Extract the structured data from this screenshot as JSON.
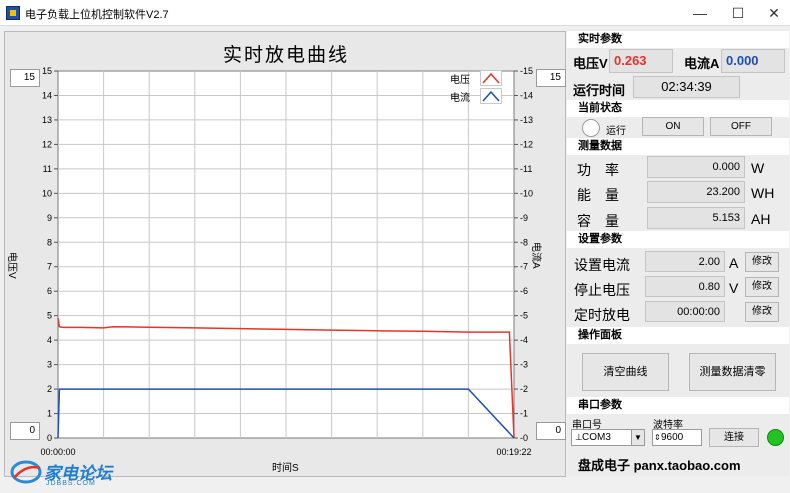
{
  "window": {
    "title": "电子负载上位机控制软件V2.7",
    "minimize_glyph": "—",
    "maximize_glyph": "☐",
    "close_glyph": "✕",
    "icon": "labview-app-icon"
  },
  "chart": {
    "title": "实时放电曲线",
    "y_left_max_box": "15",
    "y_left_min_box": "0",
    "y_right_max_box": "15",
    "y_right_min_box": "0",
    "x_start_label": "00:00:00",
    "x_end_label": "00:19:22"
  },
  "chart_data": {
    "type": "line",
    "title": "实时放电曲线",
    "xlabel": "时间S",
    "ylabel": "电压V",
    "y2label": "电流A",
    "xlim": [
      "00:00:00",
      "00:19:22"
    ],
    "ylim": [
      0,
      15
    ],
    "y2lim": [
      0,
      15
    ],
    "x_tick_labels": [
      "00:00:00",
      "00:19:22"
    ],
    "y_ticks": [
      0,
      1,
      2,
      3,
      4,
      5,
      6,
      7,
      8,
      9,
      10,
      11,
      12,
      13,
      14,
      15
    ],
    "y_tick_labels": [
      "0",
      "1",
      "2",
      "3",
      "4",
      "5",
      "6",
      "7",
      "8",
      "9",
      "10",
      "11",
      "12",
      "13",
      "14",
      "15"
    ],
    "y2_tick_labels": [
      "-0",
      "-1",
      "-2",
      "-3",
      "-4",
      "-5",
      "-6",
      "-7",
      "-8",
      "-9",
      "-10",
      "-11",
      "-12",
      "-13",
      "-14",
      "-15"
    ],
    "grid": true,
    "legend_position": "top-right",
    "series": [
      {
        "name": "电压",
        "color": "#e8332a",
        "x": [
          0,
          0.003,
          0.01,
          0.05,
          0.1,
          0.12,
          0.2,
          0.3,
          0.4,
          0.5,
          0.6,
          0.7,
          0.8,
          0.9,
          0.95,
          0.99,
          1.0
        ],
        "values": [
          4.9,
          4.55,
          4.52,
          4.52,
          4.5,
          4.55,
          4.53,
          4.5,
          4.47,
          4.44,
          4.41,
          4.38,
          4.36,
          4.33,
          4.33,
          4.33,
          0.0
        ]
      },
      {
        "name": "电流",
        "color": "#1b4fb8",
        "x": [
          0,
          0.003,
          0.01,
          0.1,
          0.3,
          0.5,
          0.7,
          0.8,
          0.9,
          1.0
        ],
        "values": [
          0.0,
          2.0,
          2.0,
          2.0,
          2.0,
          2.0,
          2.0,
          2.0,
          2.0,
          0.0
        ]
      }
    ]
  },
  "side": {
    "realtime": {
      "header": "实时参数",
      "voltage_label": "电压V",
      "voltage_value": "0.263",
      "current_label": "电流A",
      "current_value": "0.000",
      "runtime_label": "运行时间",
      "runtime_value": "02:34:39"
    },
    "state": {
      "header": "当前状态",
      "run_label": "运行",
      "on_label": "ON",
      "off_label": "OFF"
    },
    "measure": {
      "header": "测量数据",
      "power_label": "功　率",
      "power_value": "0.000",
      "power_unit": "W",
      "energy_label": "能　量",
      "energy_value": "23.200",
      "energy_unit": "WH",
      "capacity_label": "容　量",
      "capacity_value": "5.153",
      "capacity_unit": "AH"
    },
    "settings": {
      "header": "设置参数",
      "set_current_label": "设置电流",
      "set_current_value": "2.00",
      "set_current_unit": "A",
      "stop_voltage_label": "停止电压",
      "stop_voltage_value": "0.80",
      "stop_voltage_unit": "V",
      "timed_label": "定时放电",
      "timed_value": "00:00:00",
      "modify_label": "修改"
    },
    "ops": {
      "header": "操作面板",
      "clear_label": "清空曲线",
      "reset_label": "测量数据清零"
    },
    "serial": {
      "header": "串口参数",
      "port_label": "串口号",
      "port_value": "COM3",
      "baud_label": "波特率",
      "baud_value": "9600",
      "connect_label": "连接",
      "led_color": "#22c322"
    },
    "footer": "盘成电子 panx.taobao.com"
  },
  "watermark": {
    "logo_text": "家电论坛",
    "sub_text": "JDBBS.COM"
  },
  "colors": {
    "voltage_line": "#e8332a",
    "current_line": "#1b4fb8",
    "voltage_value_text": "#e8332a",
    "current_value_text": "#1b4fb8"
  }
}
